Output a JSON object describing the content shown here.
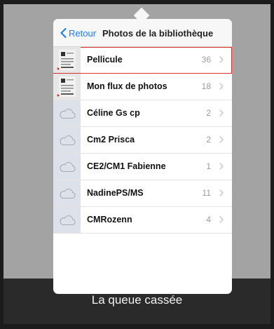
{
  "nav": {
    "back_label": "Retour",
    "title": "Photos de la bibliothèque"
  },
  "albums": [
    {
      "label": "Pellicule",
      "count": "36",
      "thumb": "photo",
      "selected": true
    },
    {
      "label": "Mon flux de photos",
      "count": "18",
      "thumb": "photo",
      "selected": false
    },
    {
      "label": "Céline Gs cp",
      "count": "2",
      "thumb": "cloud",
      "selected": false
    },
    {
      "label": "Cm2 Prisca",
      "count": "2",
      "thumb": "cloud",
      "selected": false
    },
    {
      "label": "CE2/CM1 Fabienne",
      "count": "1",
      "thumb": "cloud",
      "selected": false
    },
    {
      "label": "NadinePS/MS",
      "count": "11",
      "thumb": "cloud",
      "selected": false
    },
    {
      "label": "CMRozenn",
      "count": "4",
      "thumb": "cloud",
      "selected": false
    }
  ],
  "bottom": {
    "title": "La queue cassée"
  },
  "colors": {
    "accent": "#1a7cf5",
    "selection": "#d9302c"
  }
}
